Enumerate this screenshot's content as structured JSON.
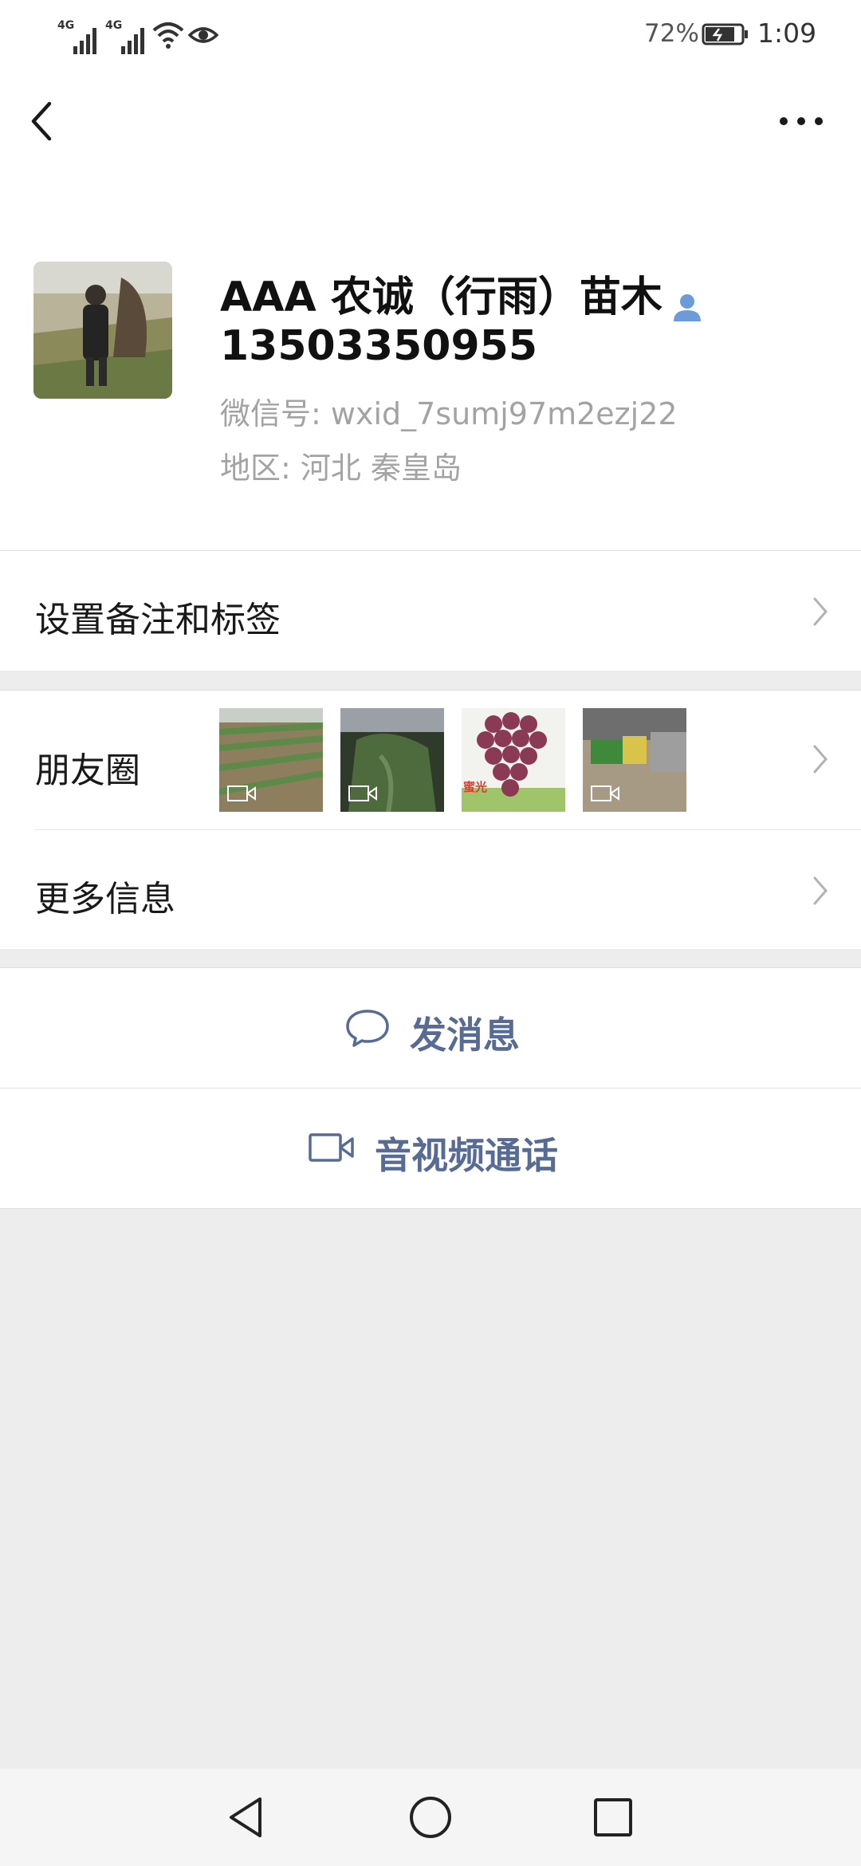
{
  "status_bar": {
    "network_1": "4G",
    "network_2": "4G",
    "battery_percent": "72%",
    "time": "1:09"
  },
  "nav": {
    "back_icon": "chevron-left-icon",
    "more_icon": "more-horizontal-icon"
  },
  "profile": {
    "name": "AAA 农诚（行雨）苗木",
    "phone": "13503350955",
    "wechat_id": "微信号: wxid_7sumj97m2ezj22",
    "region": "地区: 河北  秦皇岛",
    "contact_icon": "contact-person-icon"
  },
  "rows": {
    "remark_label": "设置备注和标签",
    "moments_label": "朋友圈",
    "more_info_label": "更多信息"
  },
  "moments_thumbs": [
    {
      "name": "moments-thumb-field",
      "video": true
    },
    {
      "name": "moments-thumb-bag",
      "video": true
    },
    {
      "name": "moments-thumb-grapes",
      "video": false,
      "caption": "蜜光"
    },
    {
      "name": "moments-thumb-yard",
      "video": true
    }
  ],
  "actions": {
    "message_label": "发消息",
    "call_label": "音视频通话"
  },
  "colors": {
    "accent": "#576b95",
    "background": "#ededed",
    "cell": "#ffffff"
  }
}
